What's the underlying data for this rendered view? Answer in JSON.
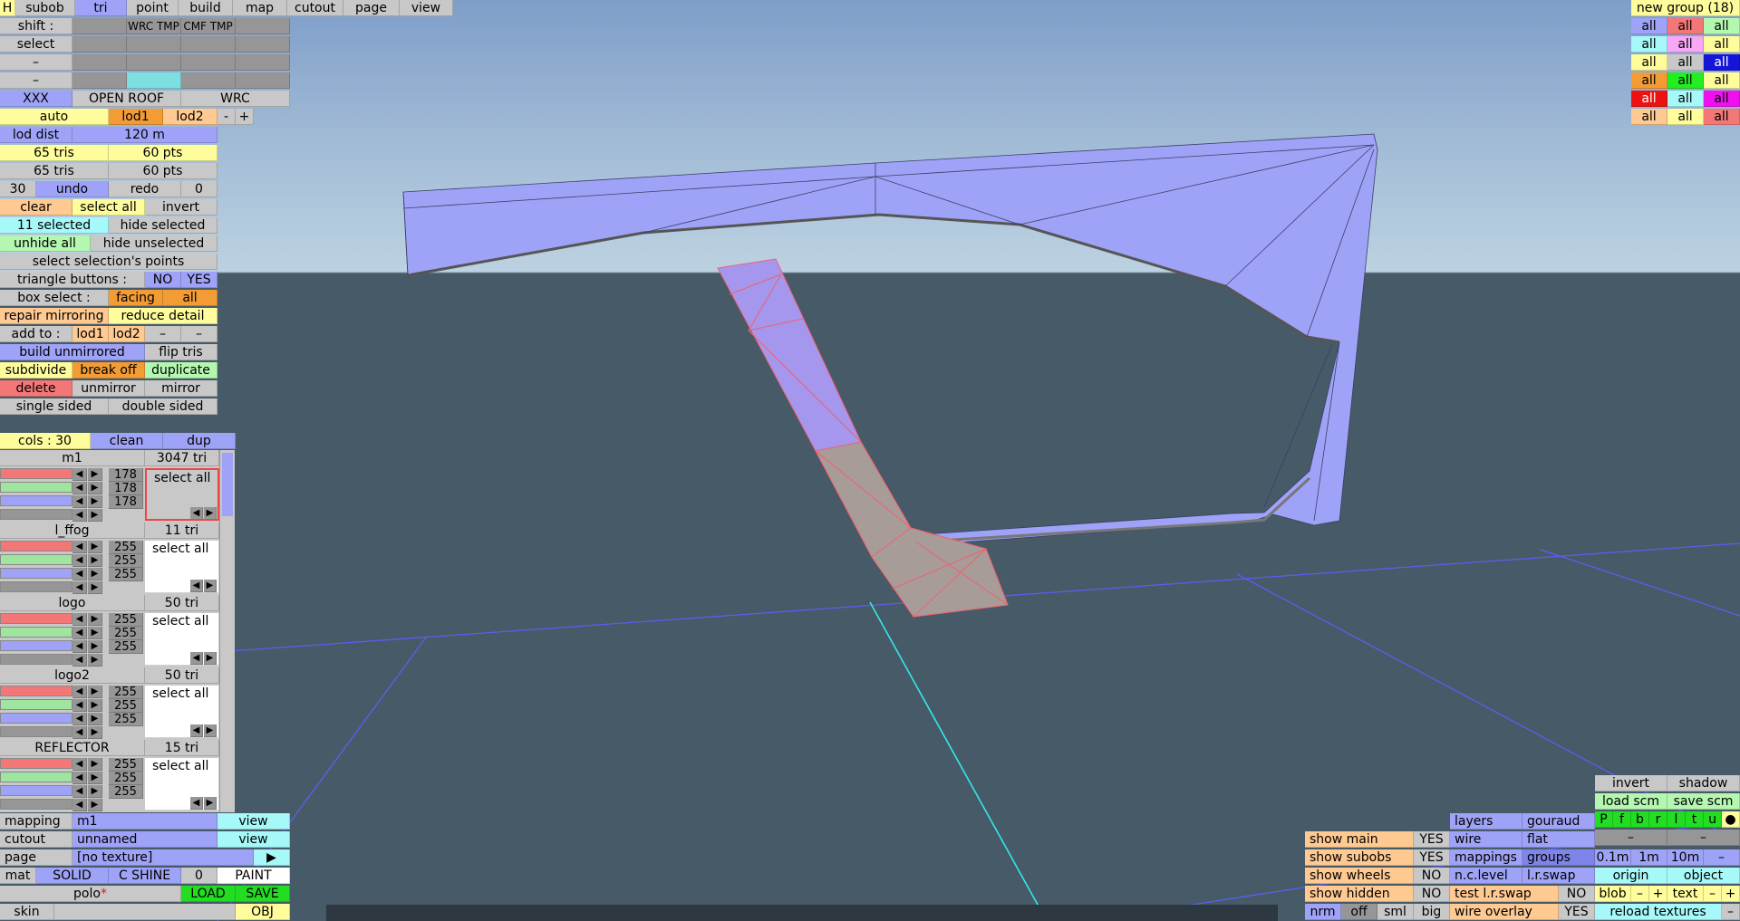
{
  "top_tabs": [
    "H",
    "subob",
    "tri",
    "point",
    "build",
    "map",
    "cutout",
    "page",
    "view"
  ],
  "left_panel": {
    "shift_label": "shift :",
    "shift_cells": [
      "",
      "",
      "WRC TMP",
      "CMF TMP",
      ""
    ],
    "select_label": "select",
    "dash1": "–",
    "dash2": "–",
    "row_xxx": [
      "XXX",
      "OPEN ROOF",
      "WRC"
    ],
    "auto": "auto",
    "lod1": "lod1",
    "lod2": "lod2",
    "minus": "-",
    "plus": "+",
    "lod_dist_label": "lod dist",
    "lod_dist_value": "120 m",
    "tris1": "65 tris",
    "pts1": "60 pts",
    "tris2": "65 tris",
    "pts2": "60 pts",
    "undo_count": "30",
    "undo": "undo",
    "redo": "redo",
    "redo_count": "0",
    "clear": "clear",
    "select_all": "select all",
    "invert": "invert",
    "selected": "11 selected",
    "hide_selected": "hide selected",
    "unhide_all": "unhide all",
    "hide_unselected": "hide unselected",
    "select_points": "select selection's points",
    "triangle_buttons": "triangle buttons :",
    "no": "NO",
    "yes": "YES",
    "box_select": "box select :",
    "facing": "facing",
    "all": "all",
    "repair_mirroring": "repair mirroring",
    "reduce_detail": "reduce detail",
    "add_to": "add to :",
    "add_lod1": "lod1",
    "add_lod2": "lod2",
    "add_minus1": "–",
    "add_minus2": "–",
    "build_unmirrored": "build unmirrored",
    "flip_tris": "flip tris",
    "subdivide": "subdivide",
    "break_off": "break off",
    "duplicate": "duplicate",
    "delete": "delete",
    "unmirror": "unmirror",
    "mirror": "mirror",
    "single_sided": "single sided",
    "double_sided": "double sided"
  },
  "colors_panel": {
    "cols": "cols : 30",
    "clean": "clean",
    "dup": "dup",
    "materials": [
      {
        "name": "m1",
        "tris": "3047 tri",
        "values": [
          "178",
          "178",
          "178"
        ],
        "select": "select all"
      },
      {
        "name": "l_ffog",
        "tris": "11 tri",
        "values": [
          "255",
          "255",
          "255"
        ],
        "select": "select all"
      },
      {
        "name": "logo",
        "tris": "50 tri",
        "values": [
          "255",
          "255",
          "255"
        ],
        "select": "select all"
      },
      {
        "name": "logo2",
        "tris": "50 tri",
        "values": [
          "255",
          "255",
          "255"
        ],
        "select": "select all"
      },
      {
        "name": "REFLECTOR",
        "tris": "15 tri",
        "values": [
          "255",
          "255",
          "255"
        ],
        "select": "select all"
      }
    ]
  },
  "bottom_left": {
    "mapping_label": "mapping",
    "mapping_value": "m1",
    "view1": "view",
    "cutout_label": "cutout",
    "cutout_value": "unnamed",
    "view2": "view",
    "page_label": "page",
    "page_value": "[no texture]",
    "page_arrow": "▶",
    "mat": "mat",
    "solid": "SOLID",
    "cshine": "C SHINE",
    "zero": "0",
    "paint": "PAINT",
    "polo": "polo",
    "polo_star": "*",
    "load": "LOAD",
    "save": "SAVE",
    "skin": "skin",
    "obj": "OBJ"
  },
  "groups_panel": {
    "title": "new group (18)",
    "cell": "all",
    "rows": [
      [
        "bl",
        "rd",
        "gr"
      ],
      [
        "cy",
        "pk",
        "yl"
      ],
      [
        "yl",
        "gy",
        "db"
      ],
      [
        "orr",
        "gn",
        "yl"
      ],
      [
        "rr",
        "cy",
        "mg"
      ],
      [
        "or",
        "yl",
        "rd"
      ]
    ]
  },
  "bottom_right": {
    "invert": "invert",
    "shadow": "shadow",
    "load_scm": "load scm",
    "save_scm": "save scm",
    "letters": [
      "P",
      "f",
      "b",
      "r",
      "l",
      "t",
      "u",
      "●"
    ],
    "dash_a": "–",
    "dash_b": "–",
    "layers": "layers",
    "gouraud": "gouraud",
    "wire": "wire",
    "flat": "flat",
    "mappings": "mappings",
    "groups": "groups",
    "nclevel": "n.c.level",
    "lrswap": "l.r.swap",
    "test_lrswap": "test l.r.swap",
    "test_no": "NO",
    "wire_overlay": "wire overlay",
    "wire_yes": "YES",
    "show_main": "show main",
    "show_main_v": "YES",
    "show_subobs": "show subobs",
    "show_subobs_v": "YES",
    "show_wheels": "show wheels",
    "show_wheels_v": "NO",
    "show_hidden": "show hidden",
    "show_hidden_v": "NO",
    "nrm": "nrm",
    "off": "off",
    "sml": "sml",
    "big": "big",
    "d01": "0.1m",
    "d1": "1m",
    "d10": "10m",
    "dminus": "–",
    "origin": "origin",
    "object": "object",
    "blob": "blob",
    "blob_minus": "–",
    "blob_plus": "+",
    "text": "text",
    "text_minus": "–",
    "text_plus": "+",
    "reload_textures": "reload textures",
    "reload_minus": "–"
  }
}
